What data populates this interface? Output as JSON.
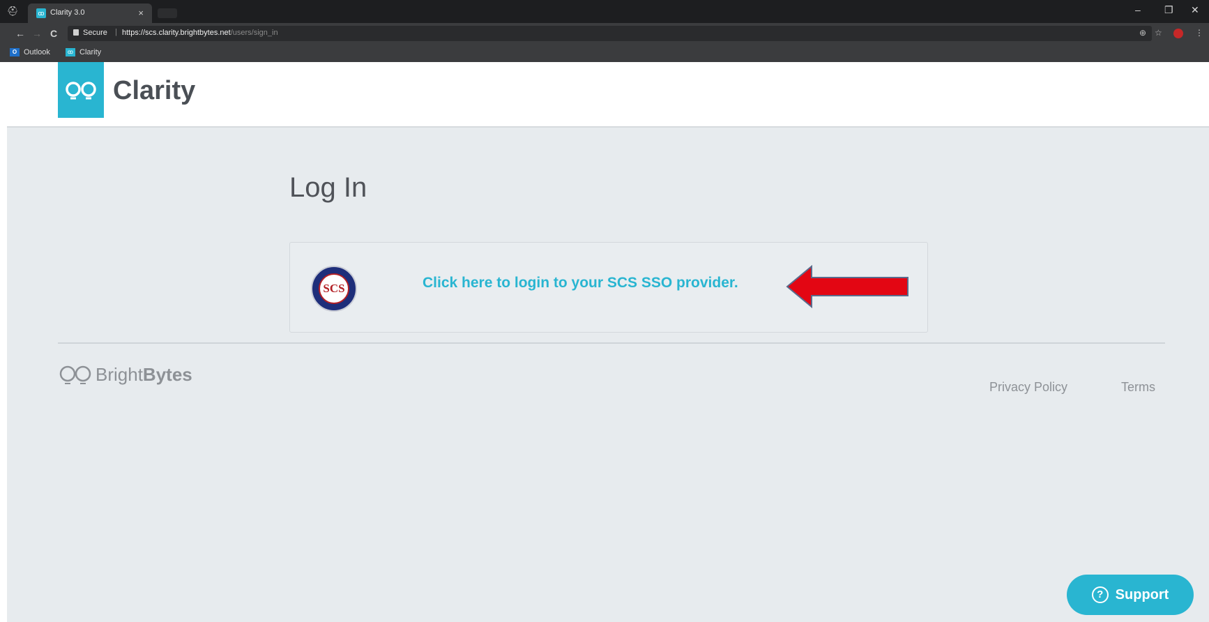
{
  "browser": {
    "tab_title": "Clarity 3.0",
    "tab_close": "×",
    "secure_label": "Secure",
    "url_host": "https://scs.clarity.brightbytes.net",
    "url_path": "/users/sign_in",
    "bookmarks": [
      {
        "label": "Outlook",
        "icon": "outlook-icon"
      },
      {
        "label": "Clarity",
        "icon": "clarity-icon"
      }
    ],
    "window_controls": {
      "minimize": "–",
      "restore": "❐",
      "close": "✕"
    },
    "nav": {
      "back": "←",
      "forward": "→",
      "reload": "C"
    }
  },
  "header": {
    "brand": "Clarity"
  },
  "login": {
    "title": "Log In",
    "sso_link": "Click here to login to your SCS SSO provider.",
    "seal_text": "SCS"
  },
  "footer": {
    "brand_light": "Bright",
    "brand_bold": "Bytes",
    "privacy": "Privacy Policy",
    "terms": "Terms"
  },
  "support": {
    "label": "Support",
    "icon_glyph": "?"
  },
  "colors": {
    "accent": "#29b5d1",
    "arrow": "#e30613",
    "page_bg": "#e7ebee"
  }
}
